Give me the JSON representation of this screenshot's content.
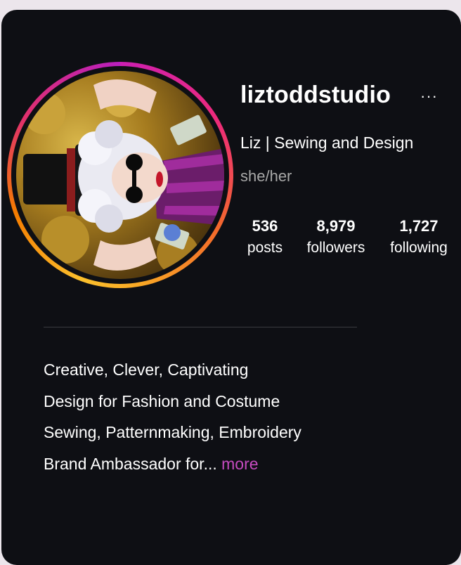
{
  "profile": {
    "username": "liztoddstudio",
    "more_icon": "more-horizontal-icon",
    "more_glyph": "···",
    "full_name": "Liz | Sewing and Design",
    "pronouns": "she/her",
    "avatar_icon": "profile-photo",
    "story_ring_colors": [
      "#cc1fb2",
      "#ee2a7b",
      "#f36a2a",
      "#fbc02d"
    ]
  },
  "stats": {
    "posts": {
      "value": "536",
      "label": "posts"
    },
    "followers": {
      "value": "8,979",
      "label": "followers"
    },
    "following": {
      "value": "1,727",
      "label": "following"
    }
  },
  "bio": {
    "lines": [
      "Creative, Clever, Captivating",
      "Design for Fashion and Costume",
      "Sewing, Patternmaking, Embroidery"
    ],
    "last_line": "Brand Ambassador for...",
    "more_label": "more",
    "more_color": "#c54bbf"
  },
  "colors": {
    "background": "#0e0f14",
    "text": "#ffffff",
    "muted_text": "#a8a8a8"
  }
}
